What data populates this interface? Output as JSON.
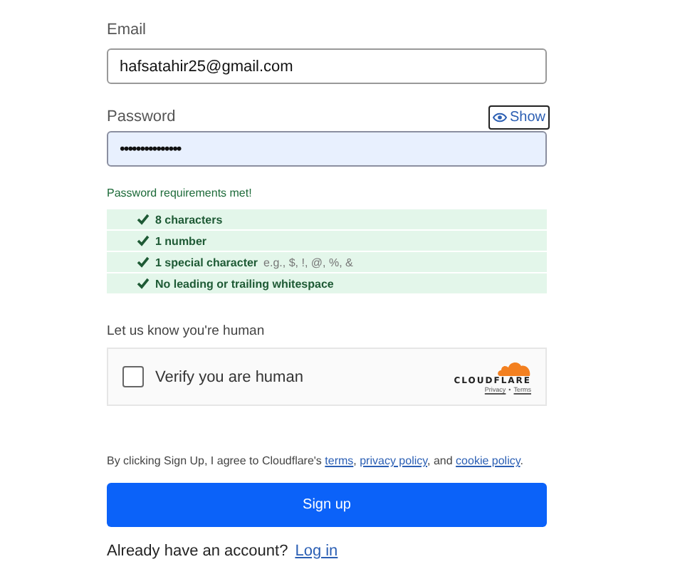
{
  "email": {
    "label": "Email",
    "value": "hafsatahir25@gmail.com"
  },
  "password": {
    "label": "Password",
    "value": "•••••••••••••••",
    "show_label": "Show"
  },
  "requirements": {
    "message": "Password requirements met!",
    "items": [
      {
        "label": "8 characters",
        "met": true
      },
      {
        "label": "1 number",
        "met": true
      },
      {
        "label": "1 special character",
        "hint": "e.g., $, !, @, %, &",
        "met": true
      },
      {
        "label": "No leading or trailing whitespace",
        "met": true
      }
    ]
  },
  "captcha": {
    "heading": "Let us know you're human",
    "label": "Verify you are human",
    "checked": false,
    "brand": "CLOUDFLARE",
    "links": [
      "Privacy",
      "Terms"
    ],
    "separator": "•"
  },
  "agreement": [
    {
      "kind": "text",
      "text": "By clicking Sign Up, I agree to Cloudflare's"
    },
    {
      "kind": "link",
      "text": "terms"
    },
    {
      "kind": "text",
      "text": ","
    },
    {
      "kind": "link",
      "text": "privacy policy"
    },
    {
      "kind": "text",
      "text": ", and"
    },
    {
      "kind": "link",
      "text": "cookie policy"
    },
    {
      "kind": "text",
      "text": "."
    }
  ],
  "submit": "Sign up",
  "login": {
    "text": "Already have an account?",
    "link": "Log in"
  }
}
